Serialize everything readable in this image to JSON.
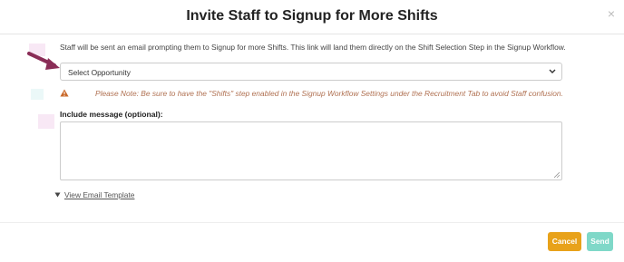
{
  "modal": {
    "title": "Invite Staff to Signup for More Shifts",
    "close_label": "×"
  },
  "body": {
    "description": "Staff will be sent an email prompting them to Signup for more Shifts. This link will land them directly on the Shift Selection Step in the Signup Workflow.",
    "select": {
      "value": "Select Opportunity"
    },
    "note": "Please Note: Be sure to have the \"Shifts\" step enabled in the Signup Workflow Settings under the Recruitment Tab to avoid Staff confusion.",
    "message_label": "Include message (optional):",
    "message_value": "",
    "template_link": "View Email Template"
  },
  "footer": {
    "cancel_label": "Cancel",
    "send_label": "Send"
  },
  "colors": {
    "note_text": "#b07152",
    "warning_icon": "#c9692a",
    "arrow": "#8a2d57",
    "cancel_button": "#e8a21a",
    "send_button": "#7fd8c8"
  }
}
